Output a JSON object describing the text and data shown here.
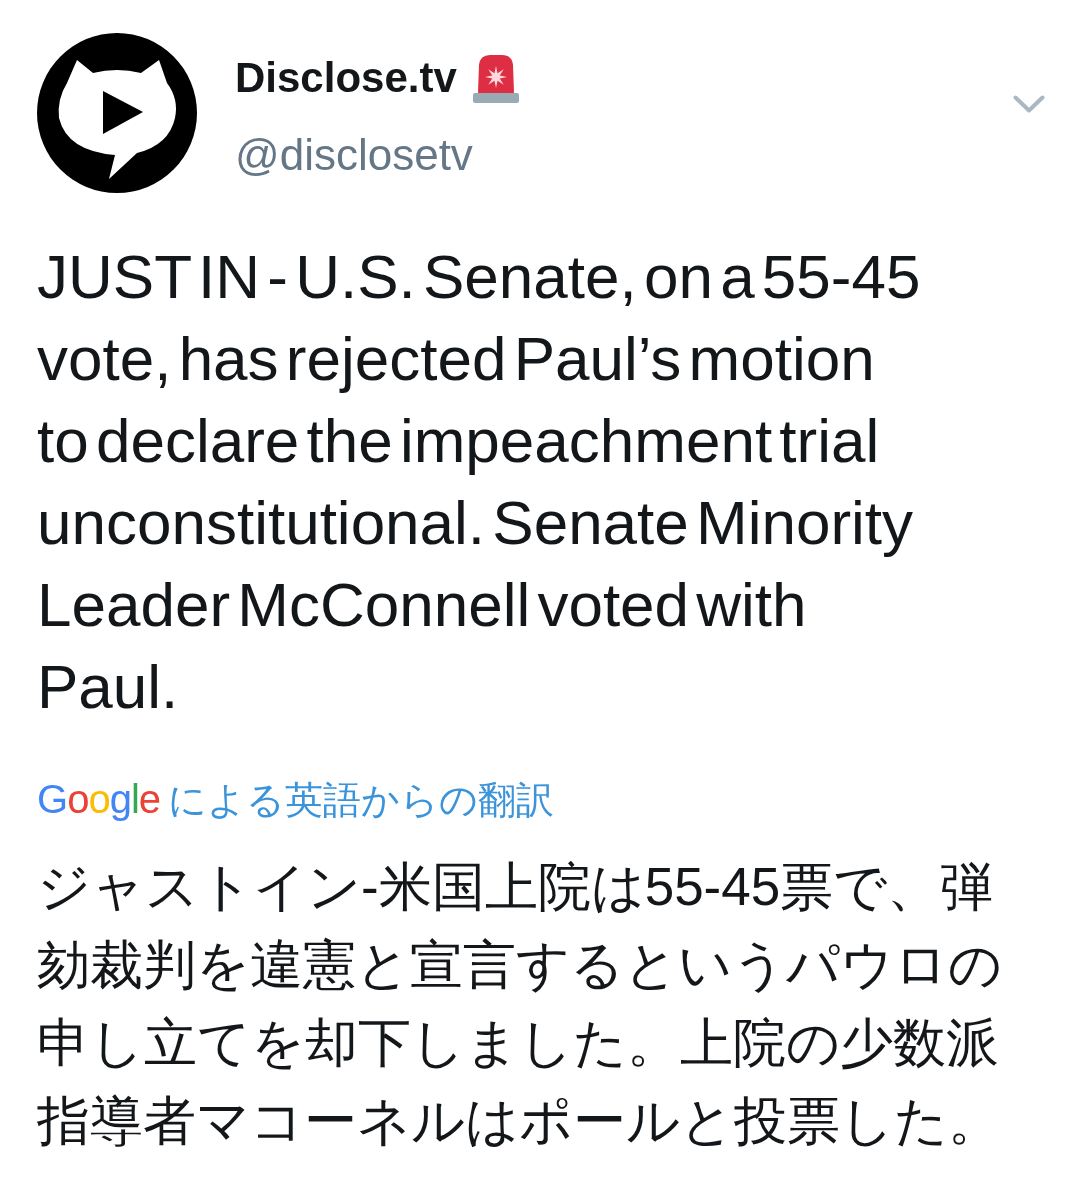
{
  "tweet": {
    "author": {
      "name": "Disclose.tv",
      "handle": "@disclosetv"
    },
    "text": "JUST IN - U.S. Senate, on a 55-45 vote, has rejected Paul’s motion to declare the impeachment trial unconstitutional. Senate Minority Leader McConnell voted with Paul.",
    "translation": {
      "provider": "Google",
      "label": "による英語からの翻訳",
      "text": "ジャストイン-米国上院は55-45票で、弾劾裁判を違憲と宣言するというパウロの申し立てを却下しました。上院の少数派指導者マコーネルはポールと投票した。"
    }
  }
}
